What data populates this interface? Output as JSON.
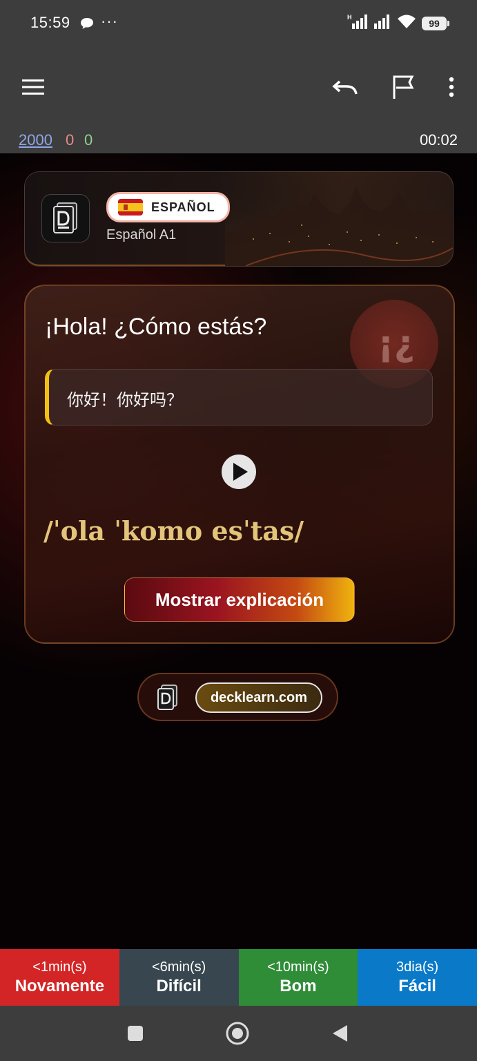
{
  "status_bar": {
    "time": "15:59",
    "dots": "···",
    "battery": "99"
  },
  "toolbar": {
    "menu_icon": "hamburger-menu-icon",
    "undo_icon": "undo-icon",
    "flag_icon": "flag-icon",
    "more_icon": "more-vertical-icon"
  },
  "counts": {
    "new": "2000",
    "learning": "0",
    "review": "0",
    "timer": "00:02",
    "colors": {
      "new": "#8fa7e8",
      "learning": "#e88a8a",
      "review": "#8fd48f"
    }
  },
  "deck_header": {
    "language": "ESPAÑOL",
    "deck_name": "Español A1"
  },
  "card": {
    "question": "¡Hola! ¿Cómo estás?",
    "deco_glyph": "¡¿",
    "translation": "你好！你好吗？",
    "ipa": "/ˈola ˈkomo esˈtas/",
    "explain_button": "Mostrar explicación",
    "accent": "#f2c012"
  },
  "footer": {
    "site": "decklearn.com"
  },
  "answers": [
    {
      "interval": "<1min(s)",
      "label": "Novamente",
      "color": "#d32526"
    },
    {
      "interval": "<6min(s)",
      "label": "Difícil",
      "color": "#37464f"
    },
    {
      "interval": "<10min(s)",
      "label": "Bom",
      "color": "#2f8c37"
    },
    {
      "interval": "3dia(s)",
      "label": "Fácil",
      "color": "#0a7ac8"
    }
  ],
  "nav": {
    "recent_icon": "square-recents-icon",
    "home_icon": "circle-home-icon",
    "back_icon": "triangle-back-icon"
  }
}
